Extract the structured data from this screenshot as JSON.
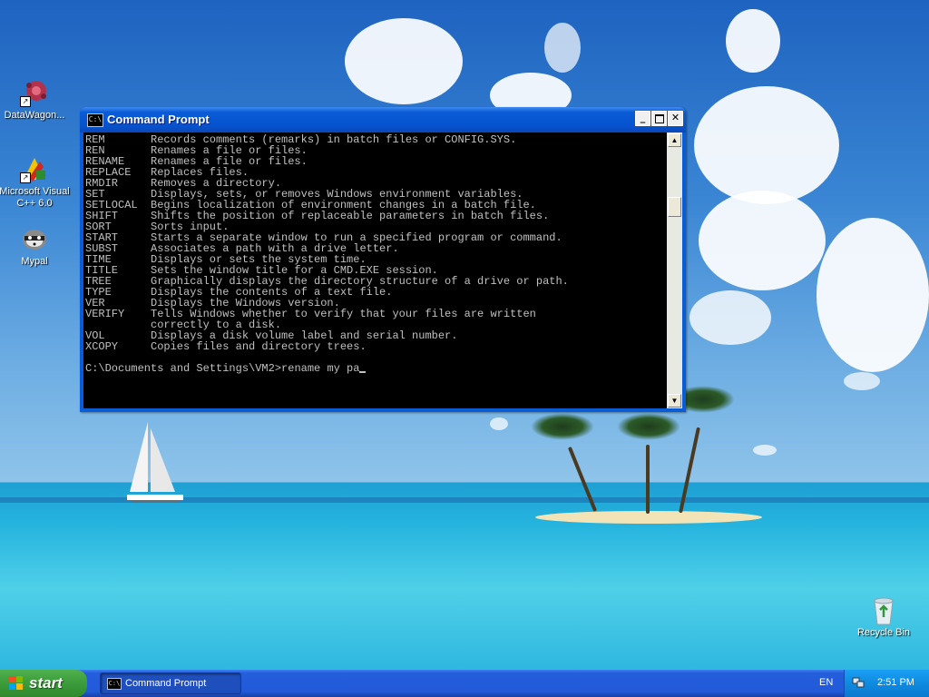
{
  "desktop": {
    "icons": [
      {
        "name": "datawagon",
        "label": "DataWagon..."
      },
      {
        "name": "visual-cpp",
        "label": "Microsoft Visual C++ 6.0"
      },
      {
        "name": "mypal",
        "label": "Mypal"
      },
      {
        "name": "recycle-bin",
        "label": "Recycle Bin"
      }
    ]
  },
  "cmd_window": {
    "title": "Command Prompt",
    "icon_text": "C:\\",
    "buttons": {
      "minimize": "_",
      "close": "✕"
    },
    "lines": [
      {
        "cmd": "REM",
        "desc": "Records comments (remarks) in batch files or CONFIG.SYS."
      },
      {
        "cmd": "REN",
        "desc": "Renames a file or files."
      },
      {
        "cmd": "RENAME",
        "desc": "Renames a file or files."
      },
      {
        "cmd": "REPLACE",
        "desc": "Replaces files."
      },
      {
        "cmd": "RMDIR",
        "desc": "Removes a directory."
      },
      {
        "cmd": "SET",
        "desc": "Displays, sets, or removes Windows environment variables."
      },
      {
        "cmd": "SETLOCAL",
        "desc": "Begins localization of environment changes in a batch file."
      },
      {
        "cmd": "SHIFT",
        "desc": "Shifts the position of replaceable parameters in batch files."
      },
      {
        "cmd": "SORT",
        "desc": "Sorts input."
      },
      {
        "cmd": "START",
        "desc": "Starts a separate window to run a specified program or command."
      },
      {
        "cmd": "SUBST",
        "desc": "Associates a path with a drive letter."
      },
      {
        "cmd": "TIME",
        "desc": "Displays or sets the system time."
      },
      {
        "cmd": "TITLE",
        "desc": "Sets the window title for a CMD.EXE session."
      },
      {
        "cmd": "TREE",
        "desc": "Graphically displays the directory structure of a drive or path."
      },
      {
        "cmd": "TYPE",
        "desc": "Displays the contents of a text file."
      },
      {
        "cmd": "VER",
        "desc": "Displays the Windows version."
      },
      {
        "cmd": "VERIFY",
        "desc": "Tells Windows whether to verify that your files are written"
      },
      {
        "cmd": "",
        "desc": "correctly to a disk."
      },
      {
        "cmd": "VOL",
        "desc": "Displays a disk volume label and serial number."
      },
      {
        "cmd": "XCOPY",
        "desc": "Copies files and directory trees."
      }
    ],
    "prompt": "C:\\Documents and Settings\\VM2>",
    "input": "rename my pa"
  },
  "taskbar": {
    "start_label": "start",
    "tasks": [
      {
        "label": "Command Prompt"
      }
    ],
    "language": "EN",
    "clock": "2:51 PM"
  },
  "colors": {
    "xp_blue": "#0a5bd6",
    "start_green": "#3c9b3a",
    "console_bg": "#000000",
    "console_fg": "#c0c0c0"
  }
}
